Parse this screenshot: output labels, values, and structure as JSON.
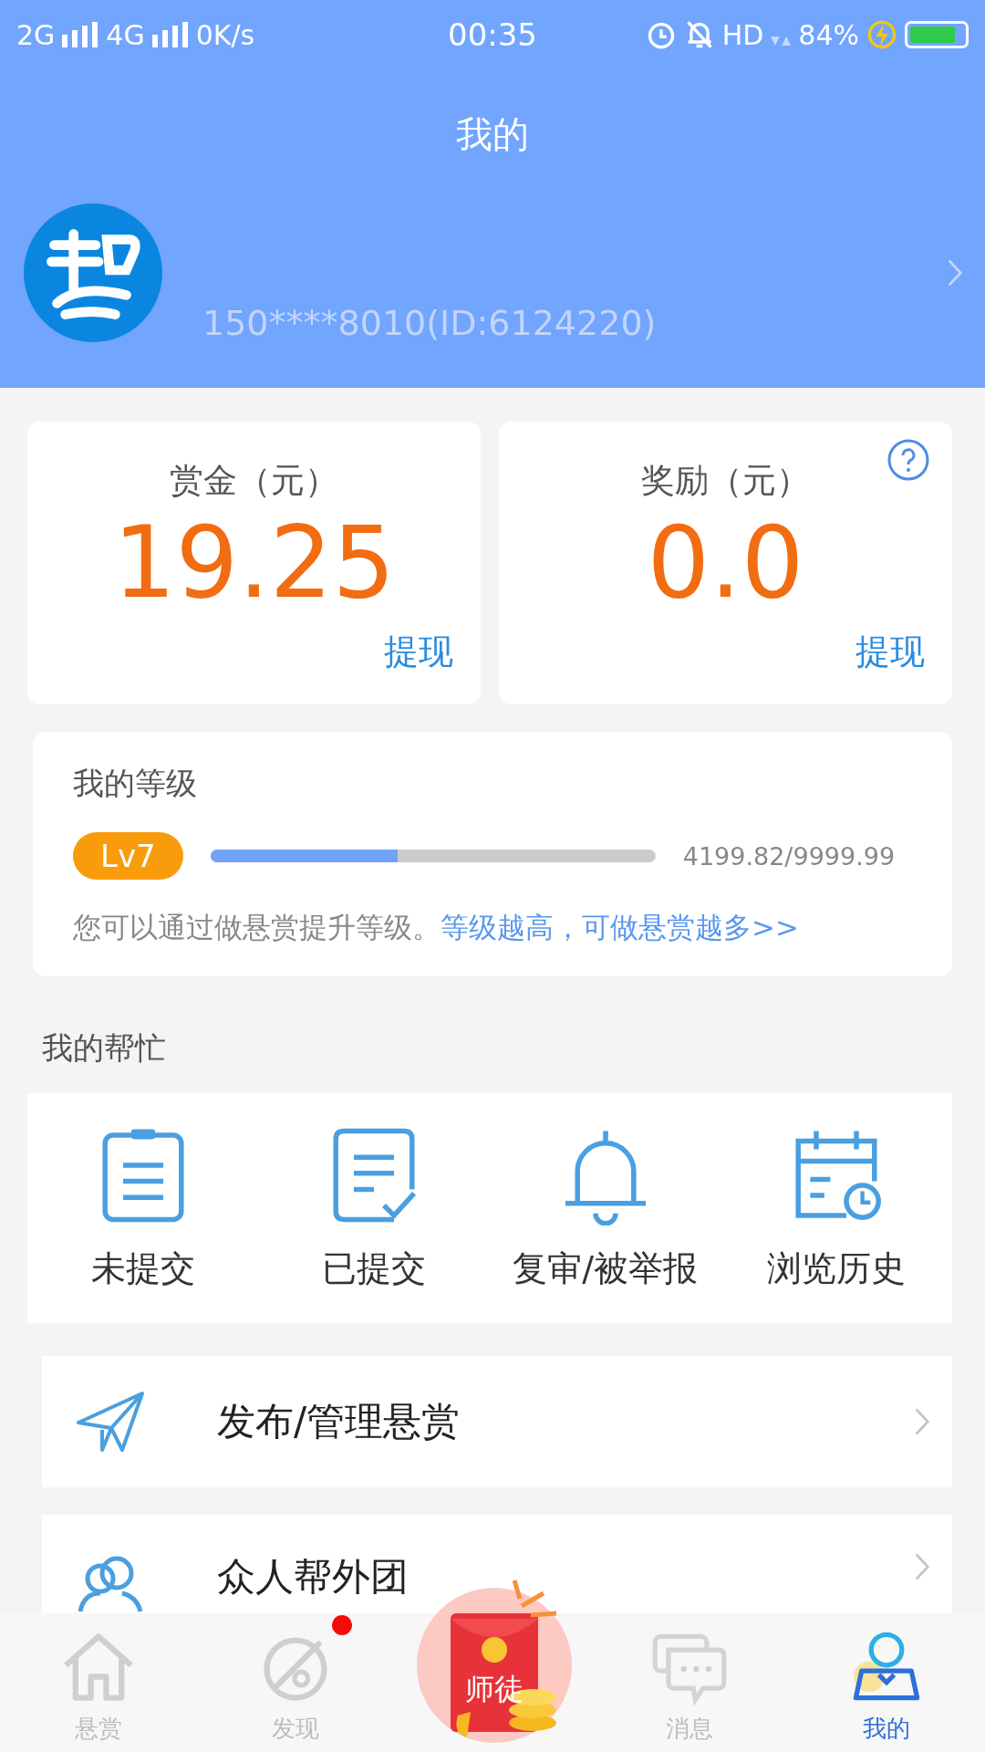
{
  "status_bar": {
    "network_1": "2G",
    "network_2": "4G",
    "speed": "0K/s",
    "time": "00:35",
    "hd": "HD",
    "battery": "84%"
  },
  "header": {
    "title": "我的"
  },
  "profile": {
    "account": "150****8010(ID:6124220)"
  },
  "balances": [
    {
      "label": "赏金（元）",
      "amount": "19.25",
      "action": "提现",
      "help": false
    },
    {
      "label": "奖励（元）",
      "amount": "0.0",
      "action": "提现",
      "help": true
    }
  ],
  "level_card": {
    "title": "我的等级",
    "badge": "Lv7",
    "level": 0.42,
    "progress": "4199.82/9999.99",
    "hint": "您可以通过做悬赏提升等级。",
    "link": "等级越高，可做悬赏越多>>"
  },
  "help_section": {
    "title": "我的帮忙",
    "items": [
      {
        "kind": "clipboard",
        "label": "未提交"
      },
      {
        "kind": "checked-doc",
        "label": "已提交"
      },
      {
        "kind": "bell",
        "label": "复审/被举报"
      },
      {
        "kind": "calendar",
        "label": "浏览历史"
      }
    ]
  },
  "menu_rows": [
    {
      "kind": "plane",
      "label": "发布/管理悬赏"
    },
    {
      "kind": "people",
      "label": "众人帮外团"
    }
  ],
  "tab_bar": [
    {
      "kind": "home",
      "label": "悬赏",
      "selected": false,
      "badge": false
    },
    {
      "kind": "discover",
      "label": "发现",
      "selected": false,
      "badge": true
    },
    {
      "kind": "envelope",
      "label": "师徒",
      "selected": false,
      "badge": false
    },
    {
      "kind": "chat",
      "label": "消息",
      "selected": false,
      "badge": false
    },
    {
      "kind": "user",
      "label": "我的",
      "selected": true,
      "badge": false
    }
  ]
}
